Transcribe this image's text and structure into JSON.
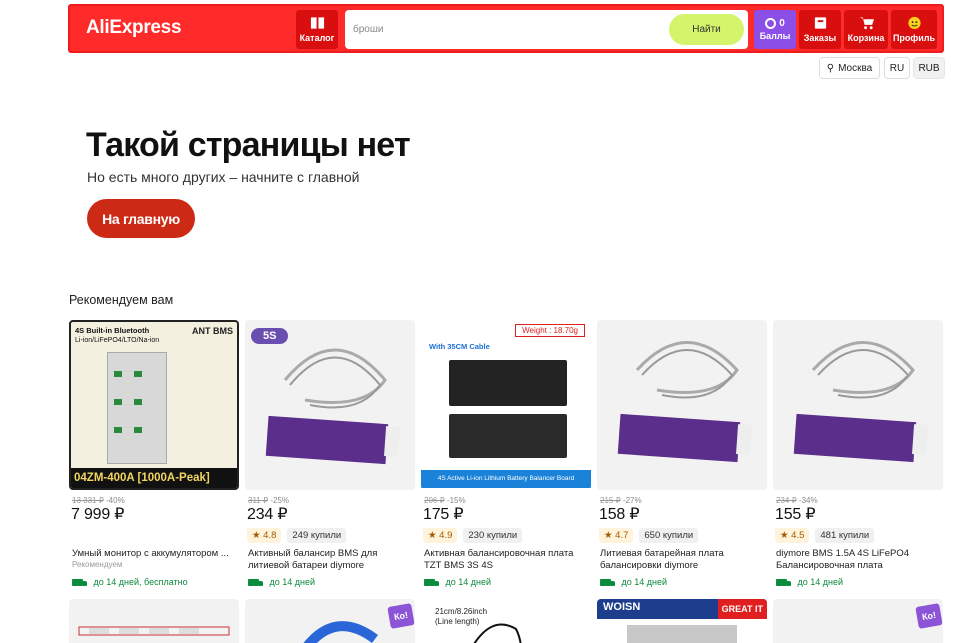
{
  "header": {
    "logo": "AliExpress",
    "catalog_label": "Каталог",
    "search_placeholder": "броши",
    "search_button": "Найти",
    "points_count": "0",
    "points_label": "Баллы",
    "orders_label": "Заказы",
    "cart_label": "Корзина",
    "profile_label": "Профиль"
  },
  "region": {
    "city": "Москва",
    "lang": "RU",
    "currency": "RUB"
  },
  "not_found": {
    "title": "Такой страницы нет",
    "subtitle": "Но есть много других – начните с главной",
    "home_button": "На главную"
  },
  "recommend": {
    "title": "Рекомендуем вам",
    "products": [
      {
        "image_top": "4S Built-in Bluetooth",
        "image_sub": "Li-ion/LiFePO4/LTO/Na-ion",
        "image_badge": "ANT BMS",
        "image_bottom": "04ZM-400A [1000A-Peak]",
        "old_price": "13 331 ₽",
        "discount": "-40%",
        "price": "7 999 ₽",
        "rating": "",
        "bought": "",
        "name": "Умный монитор с аккумулятором ...",
        "brand": "Рекомендуем",
        "delivery": "до 14 дней, бесплатно"
      },
      {
        "image_tag": "5S",
        "old_price": "311 ₽",
        "discount": "-25%",
        "price": "234 ₽",
        "rating": "4.8",
        "bought": "249 купили",
        "name": "Активный балансир BMS для литиевой батареи diymore",
        "delivery": "до 14 дней"
      },
      {
        "image_cable": "With 35CM Cable",
        "image_weight": "Weight : 18.70g",
        "image_banner": "4S Active Li-ion Lithium Battery Balancer Board",
        "old_price": "206 ₽",
        "discount": "-15%",
        "price": "175 ₽",
        "rating": "4.9",
        "bought": "230 купили",
        "name": "Активная балансировочная плата TZT BMS 3S 4S",
        "delivery": "до 14 дней"
      },
      {
        "old_price": "215 ₽",
        "discount": "-27%",
        "price": "158 ₽",
        "rating": "4.7",
        "bought": "650 купили",
        "name": "Литиевая батарейная плата балансировки diymore",
        "delivery": "до 14 дней"
      },
      {
        "old_price": "234 ₽",
        "discount": "-34%",
        "price": "155 ₽",
        "rating": "4.5",
        "bought": "481 купили",
        "name": "diymore BMS 1.5A 4S LiFePO4 Балансировочная плата",
        "delivery": "до 14 дней"
      }
    ],
    "row2": {
      "kor_badge": "Ко!",
      "length_text1": "21cm/8.26inch",
      "length_text2": "(Line length)",
      "woisn_text": "WOISN",
      "great_text": "GREAT IT"
    }
  },
  "colors": {
    "brand_red": "#ff2a2a",
    "points_purple": "#8b4fe8",
    "search_btn": "#d4f46c",
    "home_btn": "#cc2a14",
    "delivery_green": "#0c8a3d"
  }
}
